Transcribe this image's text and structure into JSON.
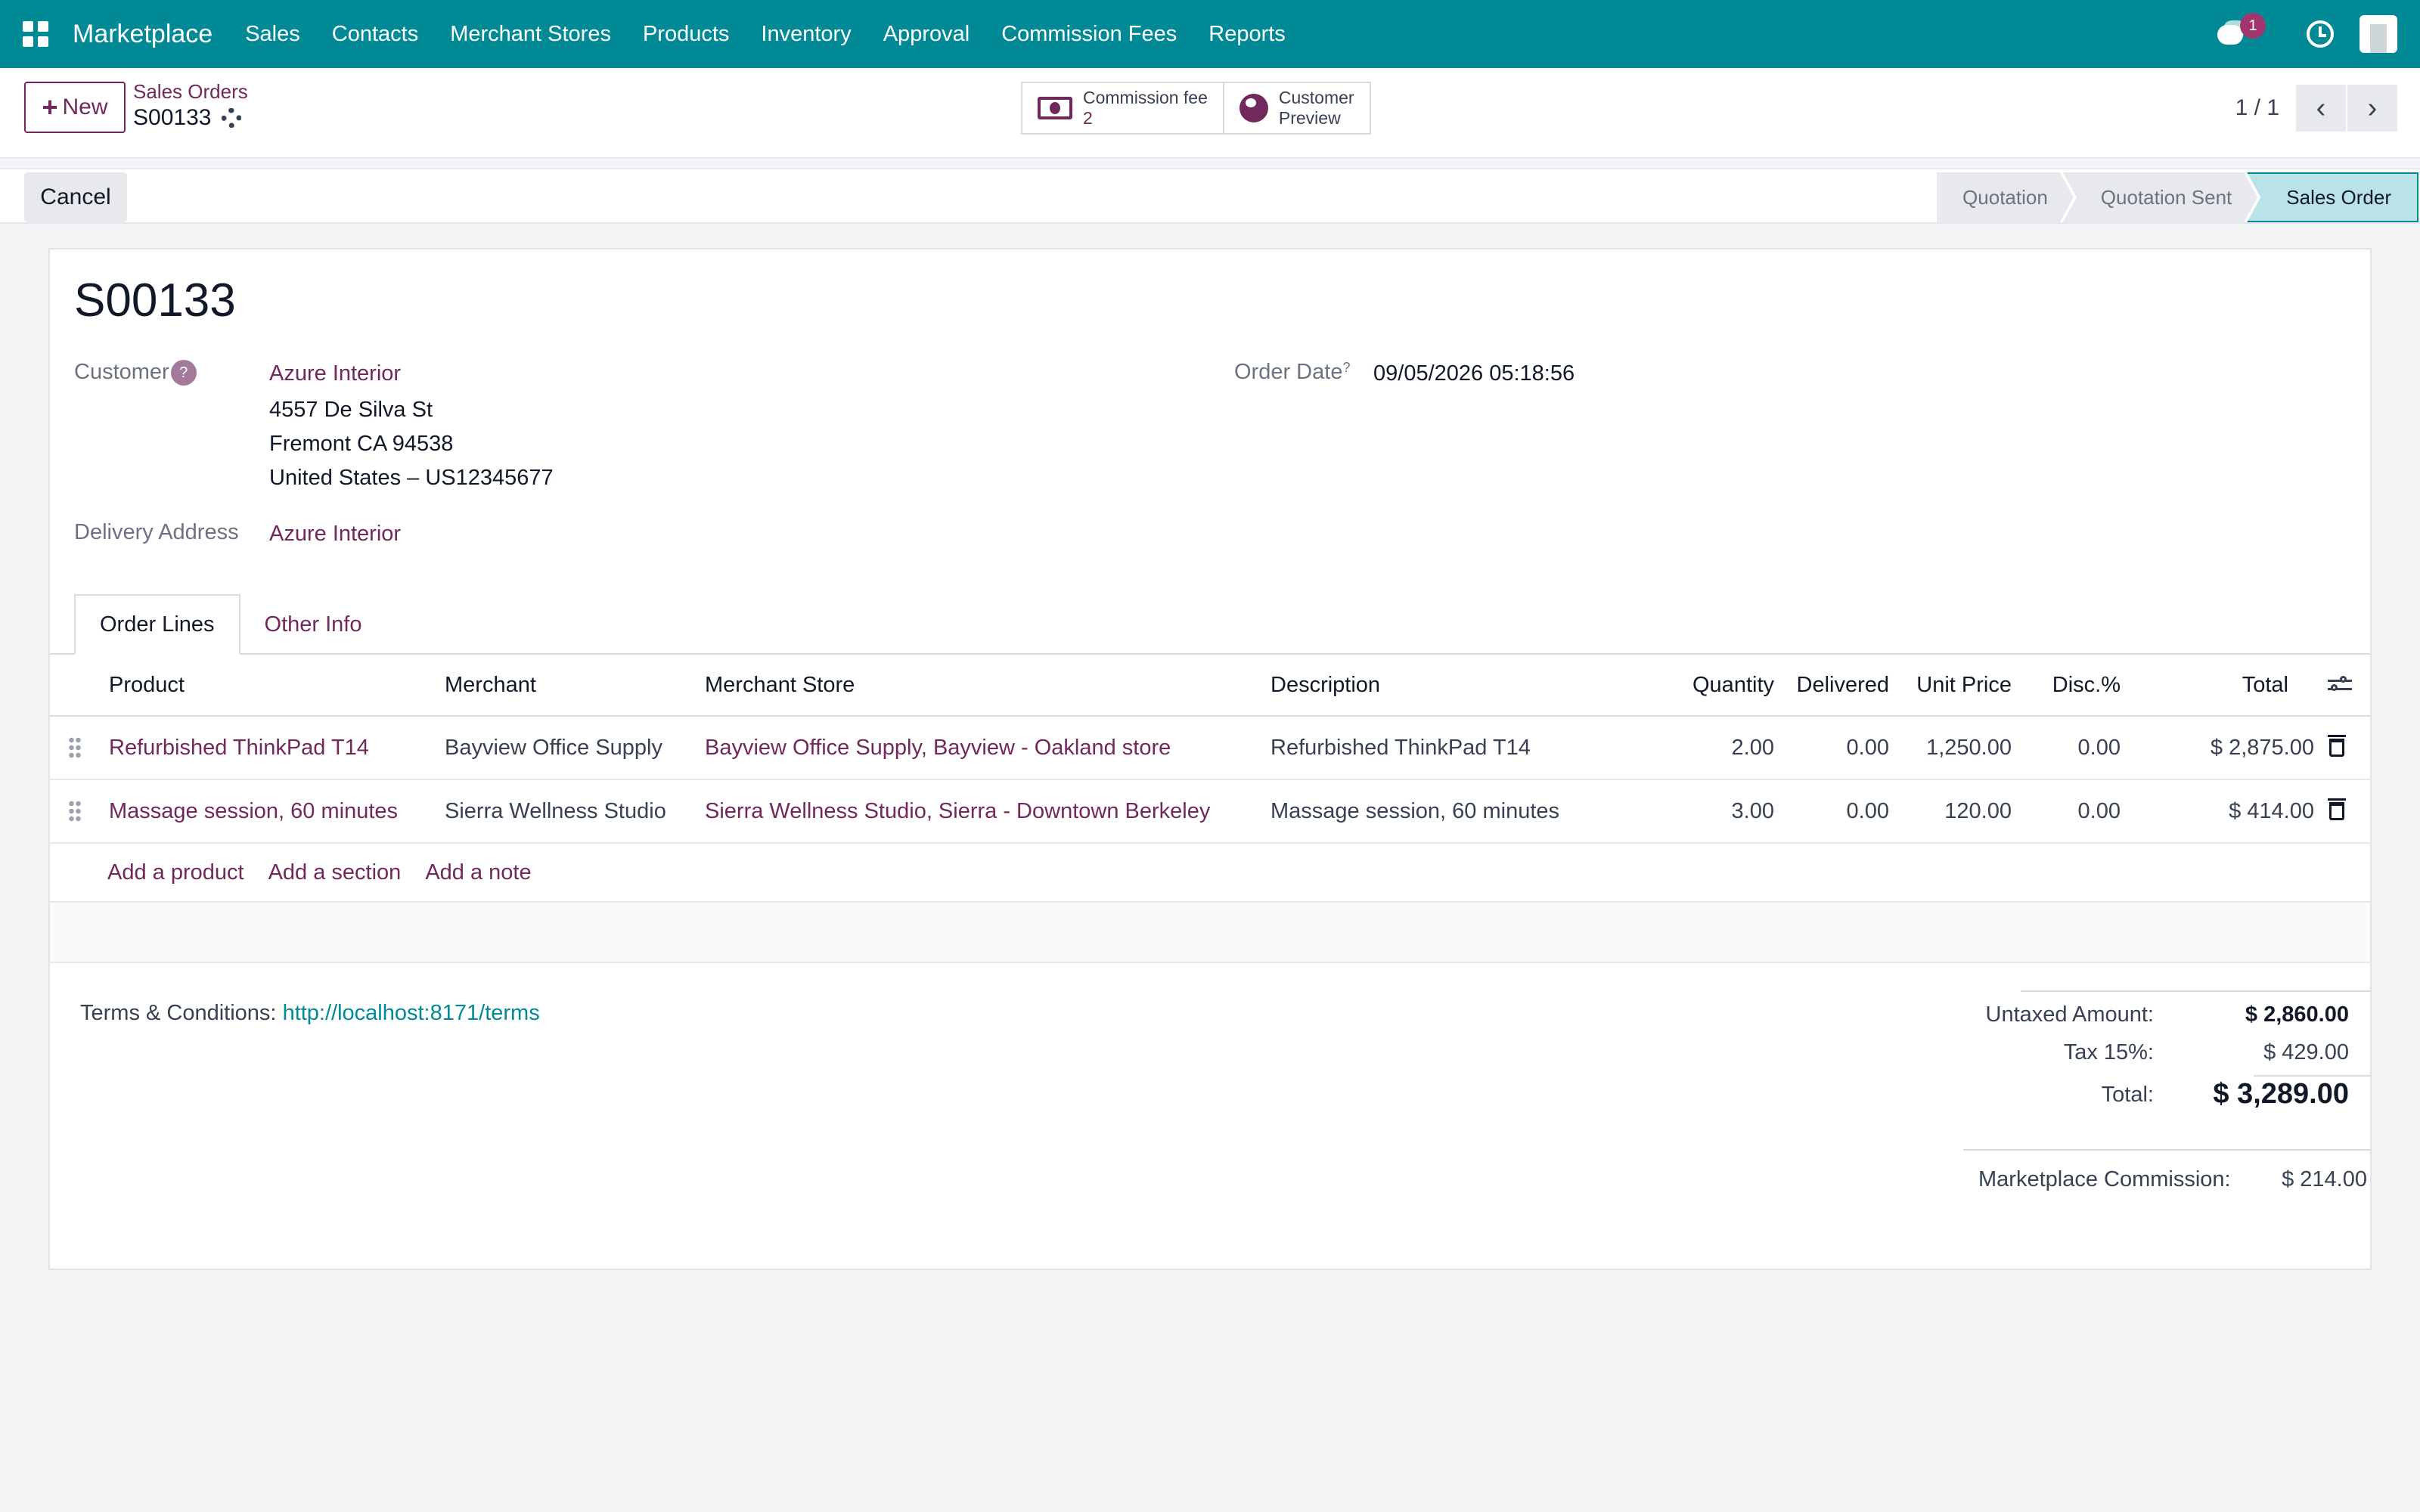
{
  "topbar": {
    "brand": "Marketplace",
    "nav": [
      "Sales",
      "Contacts",
      "Merchant Stores",
      "Products",
      "Inventory",
      "Approval",
      "Commission Fees",
      "Reports"
    ],
    "chat_badge": "1",
    "accent_color": "#018a95"
  },
  "control": {
    "new_label": "New",
    "breadcrumb_parent": "Sales Orders",
    "breadcrumb_current": "S00133",
    "smart_buttons": [
      {
        "label": "Commission fee",
        "value": "2",
        "icon": "money-icon"
      },
      {
        "label": "Customer",
        "value": "Preview",
        "icon": "globe-icon"
      }
    ],
    "pager": "1 / 1"
  },
  "statusbar": {
    "cancel_label": "Cancel",
    "stages": [
      "Quotation",
      "Quotation Sent",
      "Sales Order"
    ],
    "active_stage": "Sales Order"
  },
  "form": {
    "order_name": "S00133",
    "customer_label": "Customer",
    "customer_help": "?",
    "customer_name": "Azure Interior",
    "address_lines": [
      "4557 De Silva St",
      "Fremont CA 94538",
      "United States – US12345677"
    ],
    "delivery_label": "Delivery Address",
    "delivery_value": "Azure Interior",
    "order_date_label": "Order Date",
    "order_date_help": "?",
    "order_date_value": "09/05/2026 05:18:56"
  },
  "tabs": [
    "Order Lines",
    "Other Info"
  ],
  "lines": {
    "headers": [
      "Product",
      "Merchant",
      "Merchant Store",
      "Description",
      "Quantity",
      "Delivered",
      "Unit Price",
      "Disc.%",
      "Total"
    ],
    "rows": [
      {
        "product": "Refurbished ThinkPad T14",
        "merchant": "Bayview Office Supply",
        "store": "Bayview Office Supply, Bayview - Oakland store",
        "description": "Refurbished ThinkPad T14",
        "quantity": "2.00",
        "delivered": "0.00",
        "unit_price": "1,250.00",
        "discount": "0.00",
        "total": "$ 2,875.00"
      },
      {
        "product": "Massage session, 60 minutes",
        "merchant": "Sierra Wellness Studio",
        "store": "Sierra Wellness Studio, Sierra - Downtown Berkeley",
        "description": "Massage session, 60 minutes",
        "quantity": "3.00",
        "delivered": "0.00",
        "unit_price": "120.00",
        "discount": "0.00",
        "total": "$ 414.00"
      }
    ],
    "add_links": [
      "Add a product",
      "Add a section",
      "Add a note"
    ]
  },
  "footer": {
    "terms_label": "Terms & Conditions:",
    "terms_url": "http://localhost:8171/terms",
    "untaxed_label": "Untaxed Amount:",
    "untaxed_value": "$ 2,860.00",
    "tax_label": "Tax 15%:",
    "tax_value": "$ 429.00",
    "total_label": "Total:",
    "total_value": "$ 3,289.00",
    "commission_label": "Marketplace Commission:",
    "commission_value": "$ 214.00"
  }
}
